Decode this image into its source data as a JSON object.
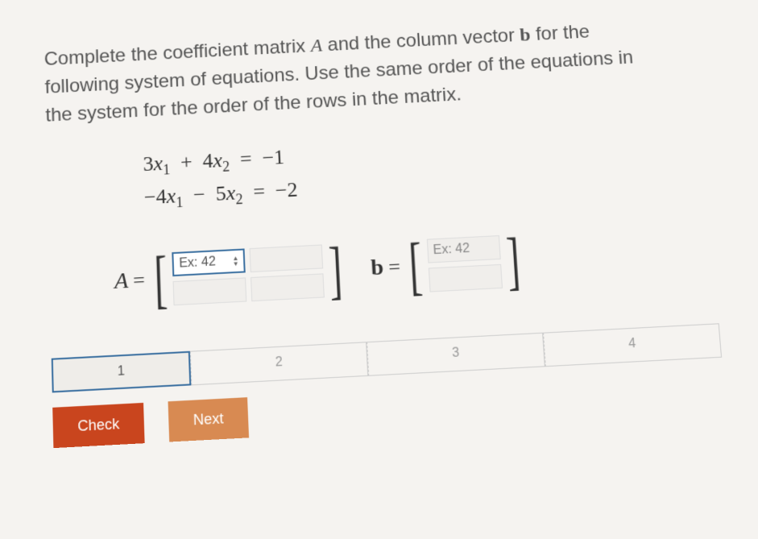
{
  "prompt": {
    "text_before_A": "Complete the coefficient matrix ",
    "A": "A",
    "text_mid": " and the column vector ",
    "b": "b",
    "text_after_b": " for the following system of equations. Use the same order of the equations in the system for the order of the rows in the matrix."
  },
  "equations": {
    "line1": "3x₁ + 4x₂ = −1",
    "line2": "−4x₁ − 5x₂ = −2",
    "eq1": {
      "c1": "3",
      "c2": "4",
      "rhs": "−1"
    },
    "eq2": {
      "c1": "−4",
      "c2": "−5",
      "rhs": "−2"
    }
  },
  "matrixA": {
    "label": "A",
    "equals": "=",
    "cells": {
      "r1c1_placeholder": "Ex: 42",
      "r1c2_placeholder": "",
      "r2c1_placeholder": "",
      "r2c2_placeholder": ""
    }
  },
  "vectorB": {
    "label": "b",
    "equals": "=",
    "cells": {
      "r1_placeholder": "Ex: 42",
      "r2_placeholder": ""
    }
  },
  "progress": {
    "steps": [
      "1",
      "2",
      "3",
      "4"
    ],
    "current_index": 0
  },
  "buttons": {
    "check": "Check",
    "next": "Next"
  }
}
